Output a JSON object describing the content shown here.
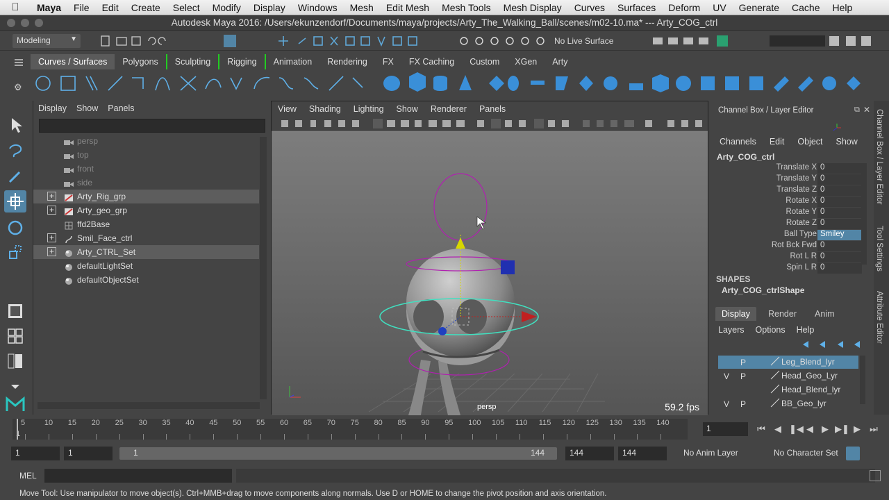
{
  "macmenu": {
    "app": "Maya",
    "items": [
      "File",
      "Edit",
      "Create",
      "Select",
      "Modify",
      "Display",
      "Windows",
      "Mesh",
      "Edit Mesh",
      "Mesh Tools",
      "Mesh Display",
      "Curves",
      "Surfaces",
      "Deform",
      "UV",
      "Generate",
      "Cache",
      "Help"
    ]
  },
  "window": {
    "title": "Autodesk Maya 2016: /Users/ekunzendorf/Documents/maya/projects/Arty_The_Walking_Ball/scenes/m02-10.ma*   ---   Arty_COG_ctrl"
  },
  "statusline": {
    "mode": "Modeling",
    "live_surface": "No Live Surface"
  },
  "shelf": {
    "tabs": [
      "Curves / Surfaces",
      "Polygons",
      "Sculpting",
      "Rigging",
      "Animation",
      "Rendering",
      "FX",
      "FX Caching",
      "Custom",
      "XGen",
      "Arty"
    ],
    "active_tab": "Curves / Surfaces"
  },
  "outliner": {
    "menu": [
      "Display",
      "Show",
      "Panels"
    ],
    "rows": [
      {
        "label": "persp",
        "expandable": false,
        "dim": true,
        "selected": false,
        "icon": "camera-icon"
      },
      {
        "label": "top",
        "expandable": false,
        "dim": true,
        "selected": false,
        "icon": "camera-icon"
      },
      {
        "label": "front",
        "expandable": false,
        "dim": true,
        "selected": false,
        "icon": "camera-icon"
      },
      {
        "label": "side",
        "expandable": false,
        "dim": true,
        "selected": false,
        "icon": "camera-icon"
      },
      {
        "label": "Arty_Rig_grp",
        "expandable": true,
        "dim": false,
        "selected": true,
        "icon": "group-icon"
      },
      {
        "label": "Arty_geo_grp",
        "expandable": true,
        "dim": false,
        "selected": false,
        "icon": "group-icon"
      },
      {
        "label": "ffd2Base",
        "expandable": false,
        "dim": false,
        "selected": false,
        "icon": "lattice-icon"
      },
      {
        "label": "Smil_Face_ctrl",
        "expandable": true,
        "dim": false,
        "selected": false,
        "icon": "curve-icon"
      },
      {
        "label": "Arty_CTRL_Set",
        "expandable": true,
        "dim": false,
        "selected": true,
        "icon": "set-icon"
      },
      {
        "label": "defaultLightSet",
        "expandable": false,
        "dim": false,
        "selected": false,
        "icon": "set-icon"
      },
      {
        "label": "defaultObjectSet",
        "expandable": false,
        "dim": false,
        "selected": false,
        "icon": "set-icon"
      }
    ]
  },
  "viewport": {
    "menu": [
      "View",
      "Shading",
      "Lighting",
      "Show",
      "Renderer",
      "Panels"
    ],
    "camera": "persp",
    "fps": "59.2 fps"
  },
  "channelbox": {
    "title": "Channel Box / Layer Editor",
    "menu": [
      "Channels",
      "Edit",
      "Object",
      "Show"
    ],
    "object": "Arty_COG_ctrl",
    "attributes": [
      {
        "name": "Translate X",
        "value": "0",
        "highlight": false
      },
      {
        "name": "Translate Y",
        "value": "0",
        "highlight": false
      },
      {
        "name": "Translate Z",
        "value": "0",
        "highlight": false
      },
      {
        "name": "Rotate X",
        "value": "0",
        "highlight": false
      },
      {
        "name": "Rotate Y",
        "value": "0",
        "highlight": false
      },
      {
        "name": "Rotate Z",
        "value": "0",
        "highlight": false
      },
      {
        "name": "Ball Type",
        "value": "Smiley",
        "highlight": true
      },
      {
        "name": "Rot Bck Fwd",
        "value": "0",
        "highlight": false
      },
      {
        "name": "Rot L R",
        "value": "0",
        "highlight": false
      },
      {
        "name": "Spin L R",
        "value": "0",
        "highlight": false
      }
    ],
    "shapes_label": "SHAPES",
    "shape_name": "Arty_COG_ctrlShape",
    "layer_tabs": [
      "Display",
      "Render",
      "Anim"
    ],
    "layer_menu": [
      "Layers",
      "Options",
      "Help"
    ],
    "layers": [
      {
        "v": "",
        "p": "P",
        "name": "Leg_Blend_lyr",
        "selected": true
      },
      {
        "v": "V",
        "p": "P",
        "name": "Head_Geo_Lyr",
        "selected": false
      },
      {
        "v": "",
        "p": "",
        "name": "Head_Blend_lyr",
        "selected": false
      },
      {
        "v": "V",
        "p": "P",
        "name": "BB_Geo_lyr",
        "selected": false
      }
    ]
  },
  "side_tabs": [
    "Channel Box / Layer Editor",
    "Tool Settings",
    "Attribute Editor"
  ],
  "timeline": {
    "ticks": [
      "5",
      "10",
      "15",
      "20",
      "25",
      "30",
      "35",
      "40",
      "45",
      "50",
      "55",
      "60",
      "65",
      "70",
      "75",
      "80",
      "85",
      "90",
      "95",
      "100",
      "105",
      "110",
      "115",
      "120",
      "125",
      "130",
      "135",
      "140"
    ],
    "start_marker": "1",
    "current_frame": "1"
  },
  "range": {
    "start": "1",
    "anim_start": "1",
    "slider_start": "1",
    "slider_end": "144",
    "anim_end": "144",
    "end": "144",
    "anim_layer": "No Anim Layer",
    "char_set": "No Character Set"
  },
  "mel": {
    "label": "MEL"
  },
  "help": {
    "text": "Move Tool: Use manipulator to move object(s). Ctrl+MMB+drag to move components along normals. Use D or HOME to change the pivot position and axis orientation."
  },
  "colors": {
    "accent": "#5285a6",
    "ring_magenta": "#b020b0",
    "ring_cyan": "#40e0c0",
    "ball": "#9a9a9a"
  }
}
